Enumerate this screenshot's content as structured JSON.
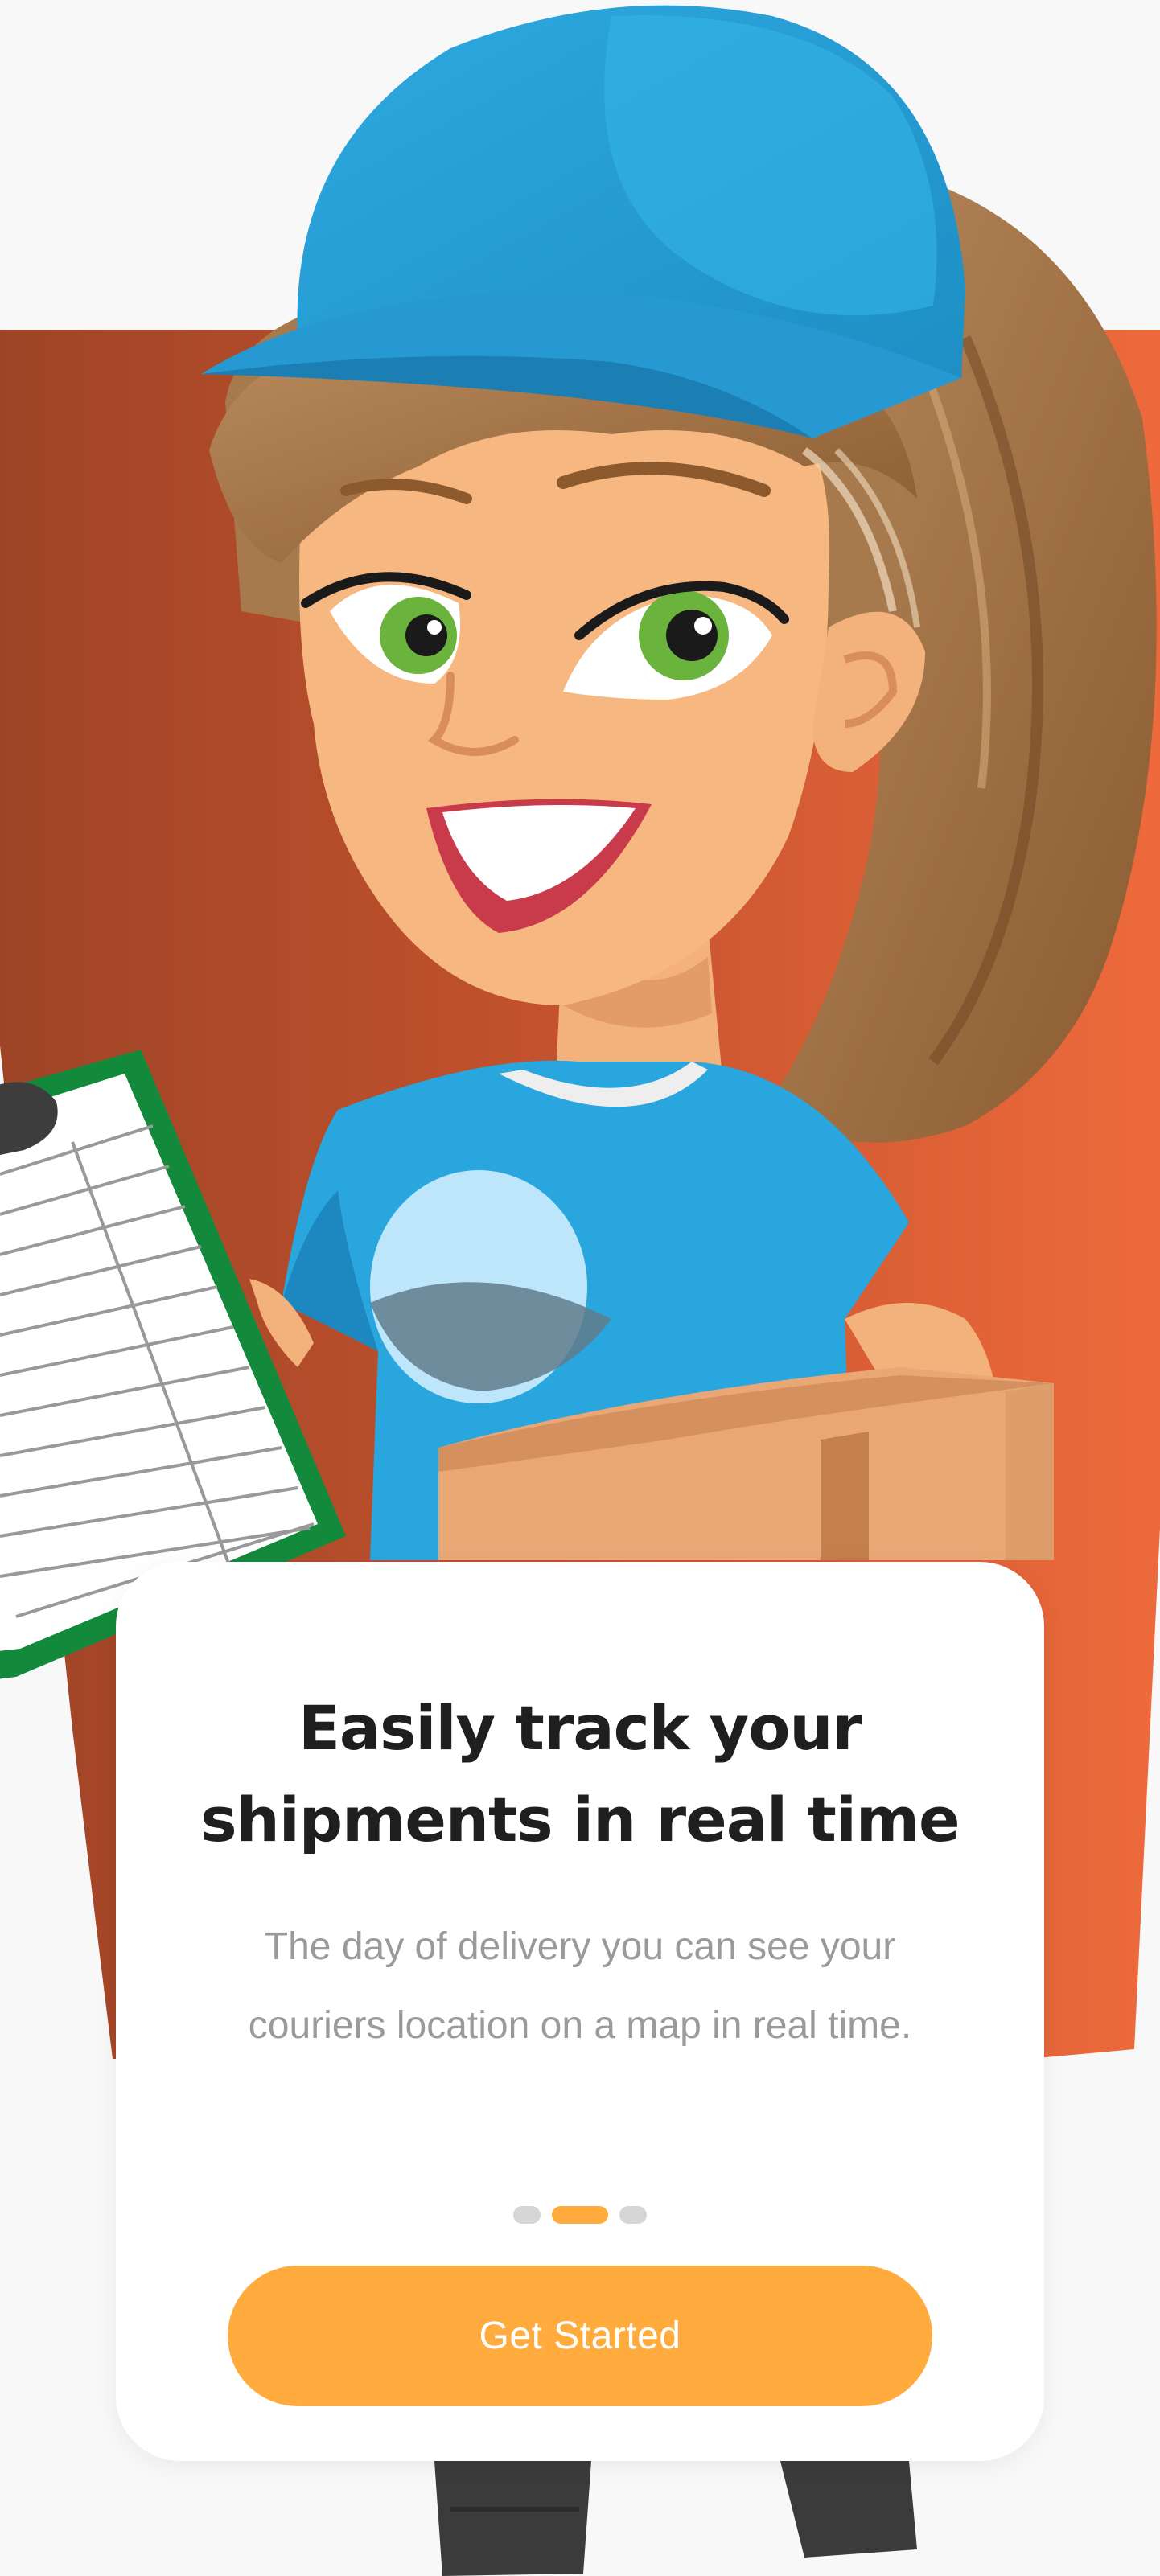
{
  "onboarding": {
    "title": "Easily track your\nshipments in real time",
    "description": "The day of delivery you can see your\ncouriers location on a map in real time.",
    "page_indicator": {
      "total": 3,
      "active_index": 1
    },
    "cta_label": "Get Started"
  },
  "illustration": {
    "subject": "delivery-woman-with-clipboard-and-box"
  },
  "colors": {
    "accent": "#ffab3e",
    "backdrop_dark": "#9e4426",
    "backdrop_light": "#ec6a3c",
    "cap": "#29a8e0",
    "shirt": "#2aa6df",
    "background": "#f8f8f8"
  }
}
